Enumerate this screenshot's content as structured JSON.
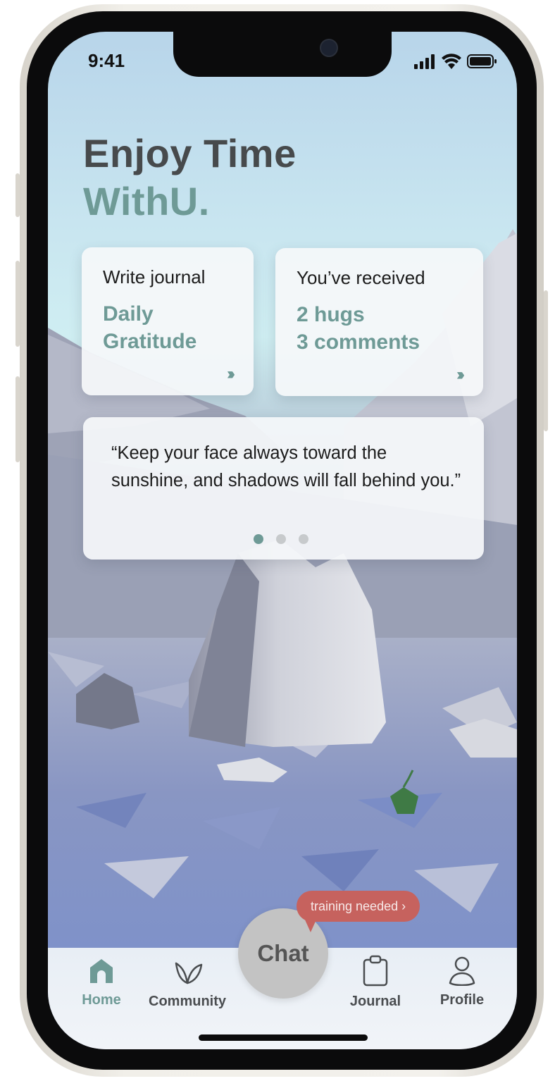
{
  "status_bar": {
    "time": "9:41"
  },
  "hero": {
    "title": "Enjoy Time",
    "brand": "WithU."
  },
  "cards": {
    "journal": {
      "label": "Write journal",
      "line1": "Daily",
      "line2": "Gratitude",
      "more": "›››"
    },
    "received": {
      "label": "You’ve received",
      "line1": "2 hugs",
      "line2": "3 comments",
      "more": "›››"
    }
  },
  "quote": {
    "text": "“Keep your face always toward the sunshine, and shadows will fall behind you.”",
    "pages": 3,
    "active_page": 1
  },
  "chat": {
    "label": "Chat",
    "badge": "training needed ›"
  },
  "tabs": [
    {
      "label": "Home",
      "icon": "home-icon",
      "active": true
    },
    {
      "label": "Community",
      "icon": "leaf-icon",
      "active": false
    },
    {
      "label": "Journal",
      "icon": "clipboard-icon",
      "active": false
    },
    {
      "label": "Profile",
      "icon": "person-icon",
      "active": false
    }
  ],
  "colors": {
    "accent": "#6e9a96",
    "title": "#474a4c",
    "badge": "#c6625e",
    "chat_button": "#c3c3c3"
  }
}
